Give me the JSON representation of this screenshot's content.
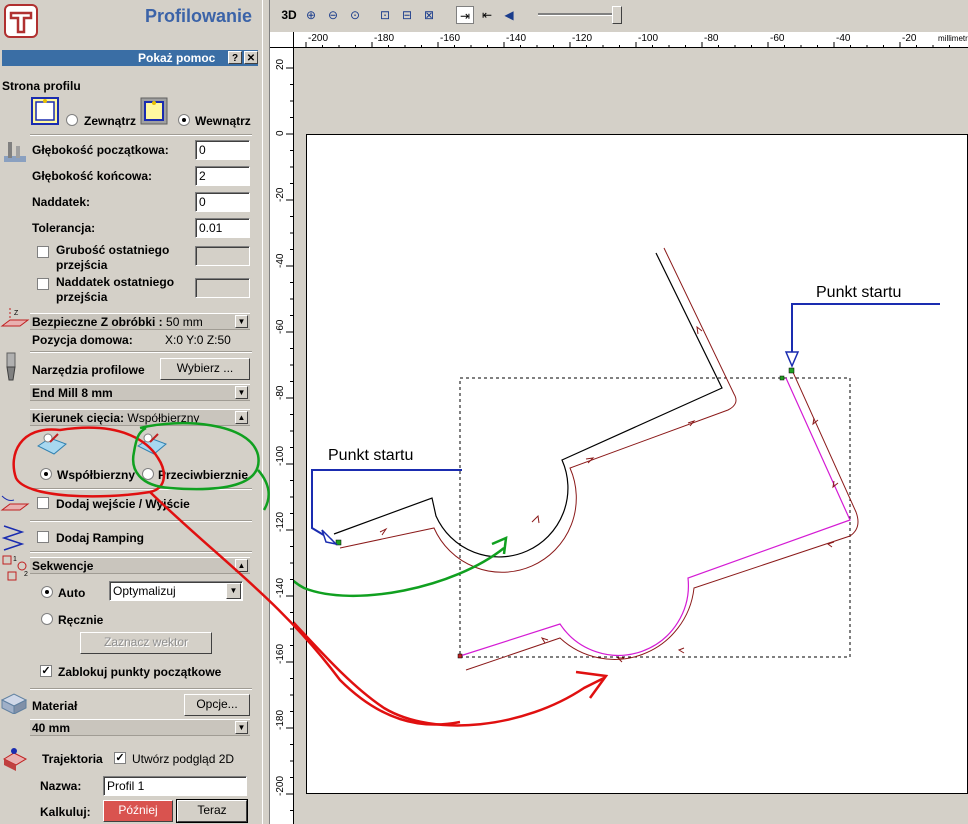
{
  "panel": {
    "title": "Profilowanie",
    "help": {
      "label": "Pokaż pomoc",
      "help_btn": "?",
      "close_btn": "✕"
    },
    "profile_side": {
      "label": "Strona profilu",
      "outside": "Zewnątrz",
      "inside": "Wewnątrz",
      "selected": "Wewnątrz"
    },
    "fields": [
      {
        "label": "Głębokość początkowa:",
        "value": "0"
      },
      {
        "label": "Głębokość końcowa:",
        "value": "2"
      },
      {
        "label": "Naddatek:",
        "value": "0"
      },
      {
        "label": "Tolerancja:",
        "value": "0.01"
      }
    ],
    "last_pass_thickness": {
      "label_line1": "Grubość ostatniego",
      "label_line2": "przejścia",
      "checked": false
    },
    "last_pass_allowance": {
      "label_line1": "Naddatek ostatniego",
      "label_line2": "przejścia",
      "checked": false
    },
    "safe_z": {
      "label": "Bezpieczne Z obróbki :",
      "value": "50 mm"
    },
    "home": {
      "label": "Pozycja domowa:",
      "value": "X:0 Y:0 Z:50"
    },
    "tools": {
      "label": "Narzędzia profilowe",
      "select_btn": "Wybierz ...",
      "tool_name": "End Mill 8 mm"
    },
    "cut_direction": {
      "label": "Kierunek cięcia:",
      "value": "Współbierzny",
      "climb": "Współbierzny",
      "conventional": "Przeciwbierznie",
      "selected": "Współbierzny"
    },
    "lead_in_out": {
      "label": "Dodaj wejście / Wyjście",
      "checked": false
    },
    "ramping": {
      "label": "Dodaj Ramping",
      "checked": false
    },
    "sequence": {
      "label": "Sekwencje",
      "auto": "Auto",
      "manual": "Ręcznie",
      "selected": "Auto",
      "option": "Optymalizuj",
      "mark_vector": "Zaznacz wektor",
      "lock_start": "Zablokuj punkty początkowe",
      "lock_checked": true
    },
    "material": {
      "label": "Materiał",
      "options_btn": "Opcje...",
      "thickness": "40 mm"
    },
    "trajectory": {
      "label": "Trajektoria",
      "preview_label": "Utwórz podgląd 2D",
      "preview_checked": true
    },
    "name": {
      "label": "Nazwa:",
      "value": "Profil 1"
    },
    "calc": {
      "label": "Kalkuluj:",
      "later": "Później",
      "now": "Teraz"
    }
  },
  "toolbar": {
    "view3d": "3D"
  },
  "ruler": {
    "unit": "millimetr",
    "h_ticks": [
      "-200",
      "-180",
      "-160",
      "-140",
      "-120",
      "-100",
      "-80",
      "-60",
      "-40",
      "-20"
    ],
    "v_ticks": [
      "20",
      "0",
      "-20",
      "-40",
      "-60",
      "-80",
      "-100",
      "-120",
      "-140",
      "-160",
      "-180",
      "-200"
    ]
  },
  "canvas": {
    "start_label_1": "Punkt startu",
    "start_label_2": "Punkt startu"
  },
  "colors": {
    "accent": "#3a6ea5",
    "later_btn": "#d9534f",
    "path": "#8b1a1a",
    "toolpath_alt": "#d41bd4",
    "annot_blue": "#1a2cb0"
  }
}
